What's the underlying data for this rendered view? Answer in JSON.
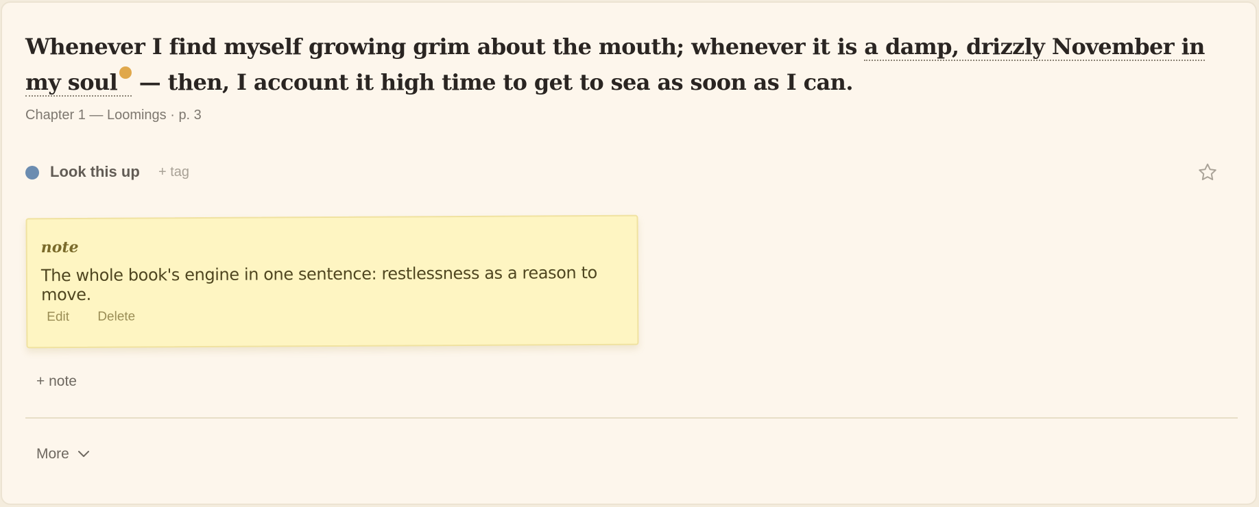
{
  "quote": {
    "before": "Whenever I find myself growing grim about the mouth; whenever it is ",
    "highlight": "a damp, drizzly November in my soul",
    "after": " — then, I account it high time to get to sea as soon as I can."
  },
  "meta": "Chapter 1 — Loomings · p. 3",
  "tag": {
    "label": "Look this up",
    "add_label": "+ tag",
    "color": "#6b8cb0"
  },
  "highlight_dot_color": "#e0a84c",
  "star_icon": "star-outline-icon",
  "note": {
    "title": "note",
    "body": "The whole book's engine in one sentence: restlessness as a reason to move.",
    "edit_label": "Edit",
    "delete_label": "Delete"
  },
  "add_note_label": "+ note",
  "more_label": "More"
}
